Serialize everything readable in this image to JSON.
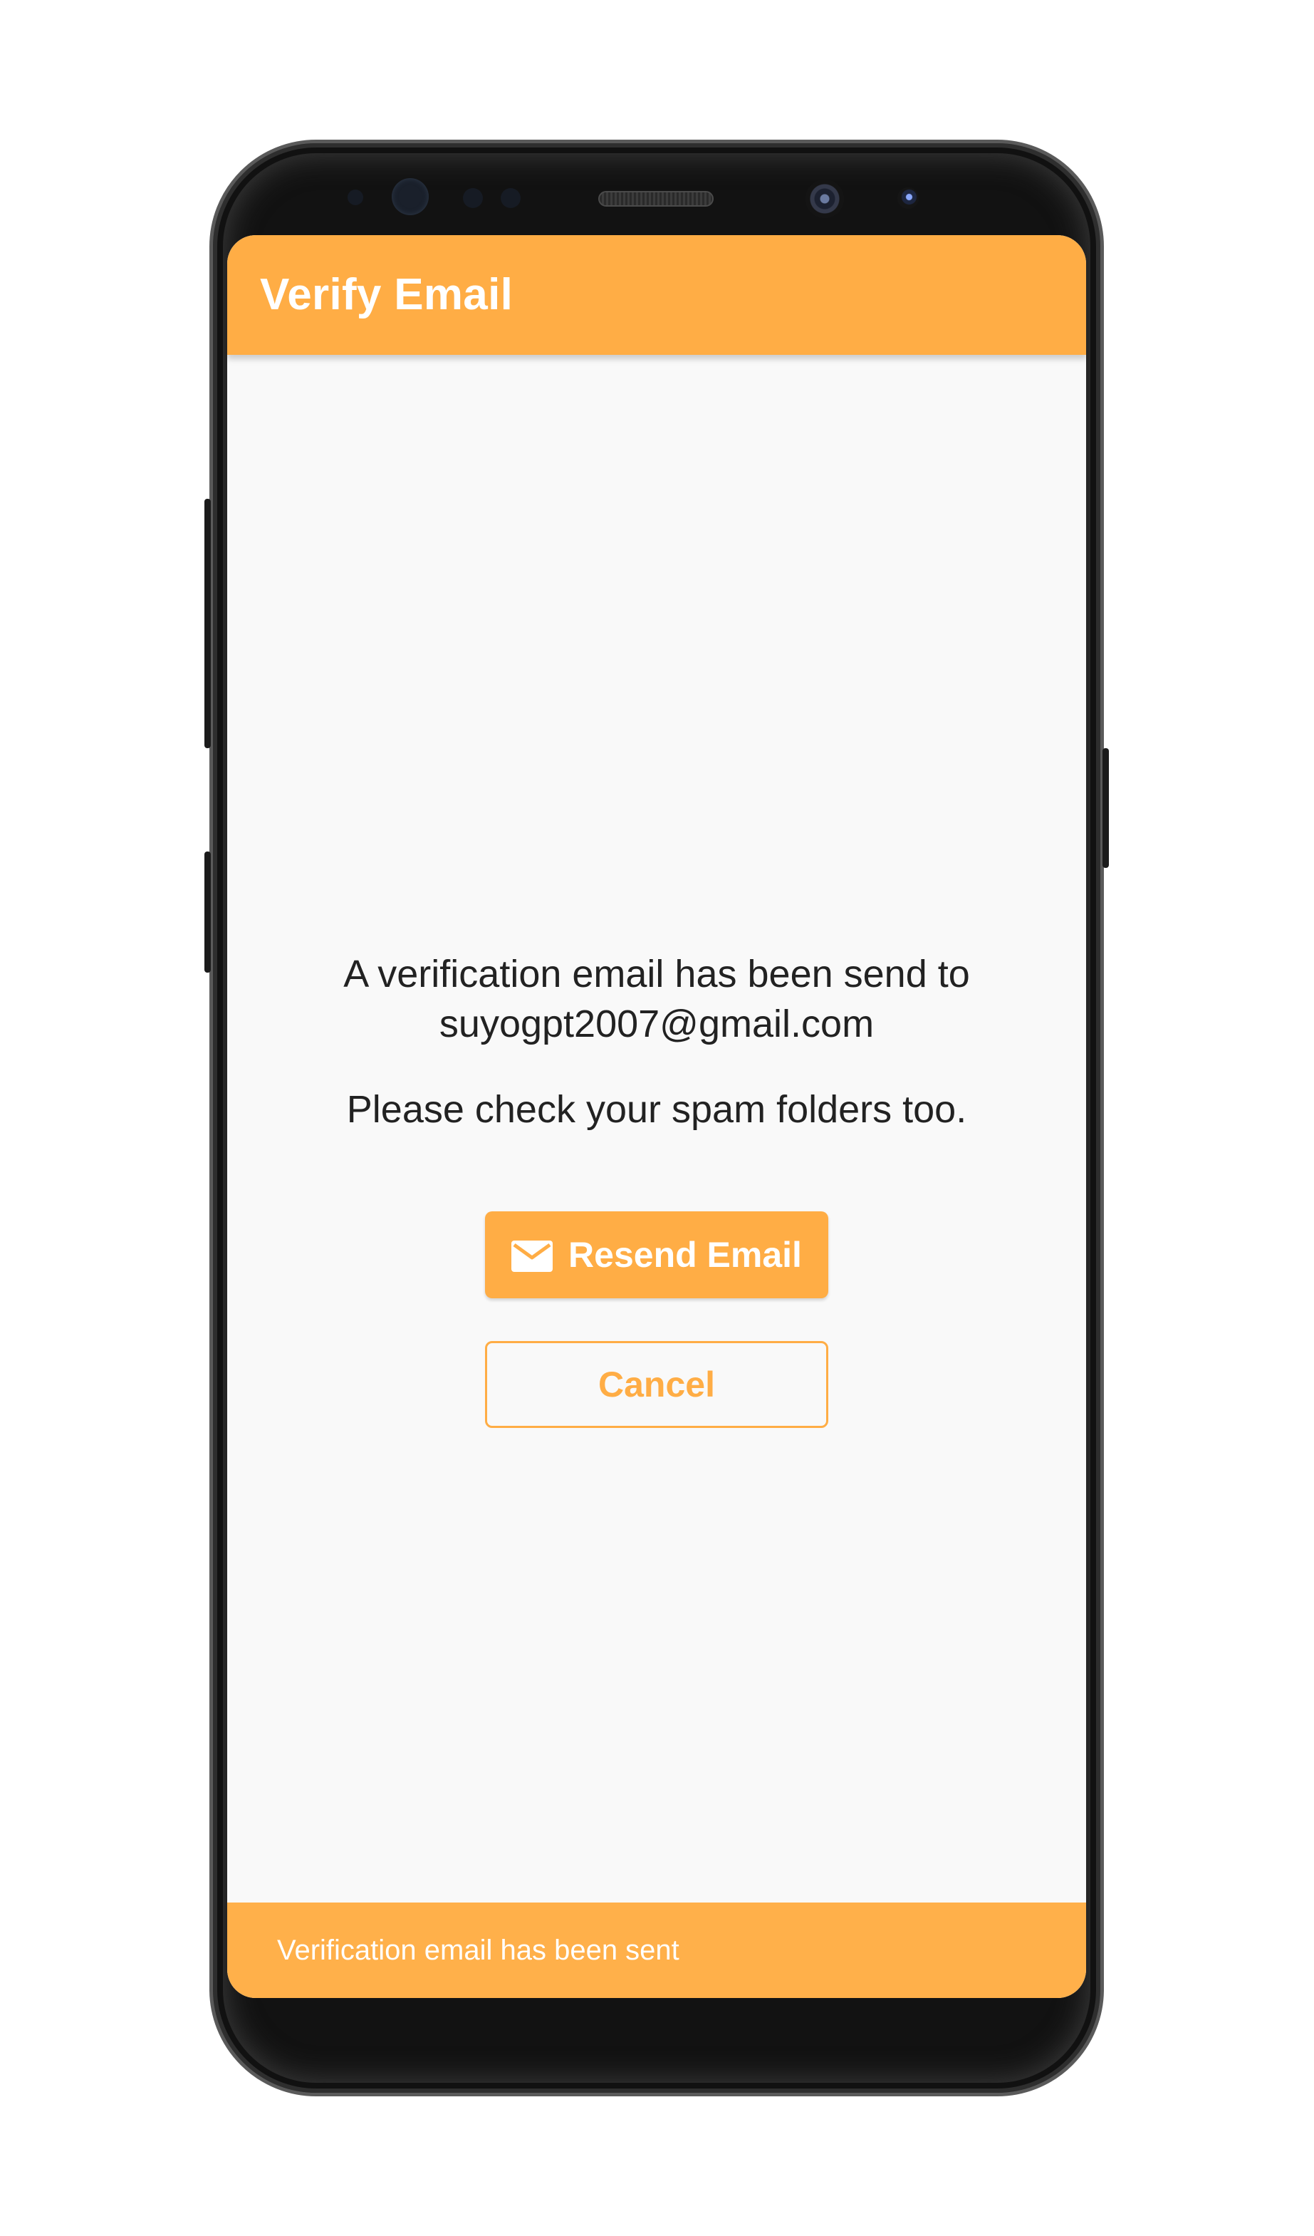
{
  "app_bar": {
    "title": "Verify Email"
  },
  "message": {
    "line1": "A verification email has been send to",
    "email": "suyogpt2007@gmail.com",
    "spam_note": "Please check your spam folders too."
  },
  "actions": {
    "resend_label": "Resend Email",
    "resend_icon": "mail-icon",
    "cancel_label": "Cancel"
  },
  "snackbar": {
    "text": "Verification email has been sent"
  },
  "colors": {
    "accent": "#ffad45",
    "background": "#f9f9f9",
    "text": "#222222",
    "on_accent": "#ffffff"
  }
}
